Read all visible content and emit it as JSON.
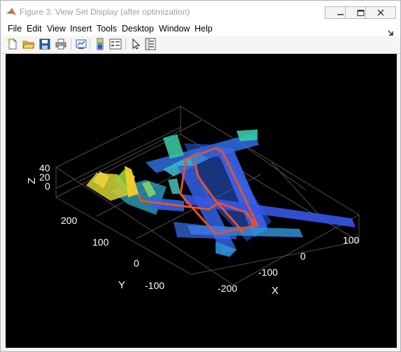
{
  "window": {
    "title": "Figure 3: View Set Display (after optimization)"
  },
  "menu": [
    "File",
    "Edit",
    "View",
    "Insert",
    "Tools",
    "Desktop",
    "Window",
    "Help"
  ],
  "toolbar": {
    "buttons": [
      "new-figure-icon",
      "open-file-icon",
      "save-icon",
      "print-icon",
      "link-plot-icon",
      "colorbar-icon",
      "legend-icon",
      "pointer-icon",
      "property-inspector-icon"
    ]
  },
  "axes": {
    "xlabel": "X",
    "ylabel": "Y",
    "zlabel": "Z",
    "x_ticks": [
      "-200",
      "-100",
      "0",
      "100"
    ],
    "y_ticks": [
      "-100",
      "0",
      "100",
      "200"
    ],
    "z_ticks": [
      "40",
      "20",
      "0"
    ]
  },
  "colors": {
    "trajectory": "#e8502a",
    "background": "#000000",
    "grid": "#4d4d4d"
  },
  "point_cloud": "colormap: parula (blue to yellow by height)"
}
